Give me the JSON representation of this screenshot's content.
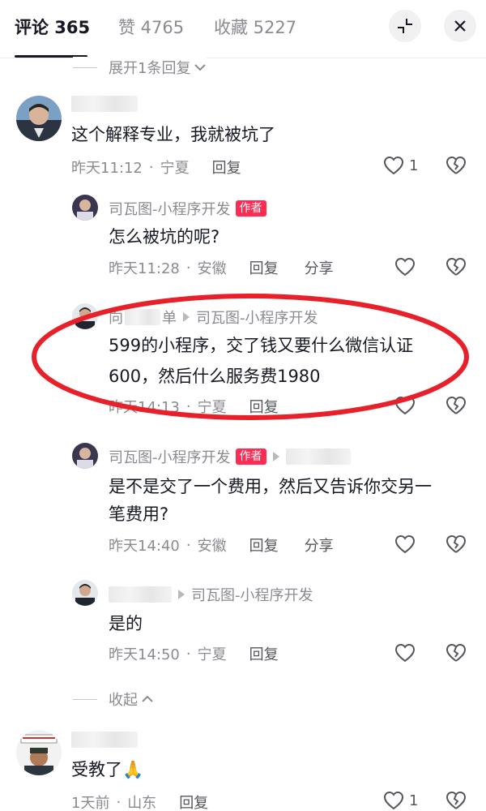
{
  "header": {
    "tabs": [
      {
        "label": "评论 365",
        "active": true
      },
      {
        "label": "赞 4765",
        "active": false
      },
      {
        "label": "收藏 5227",
        "active": false
      }
    ],
    "shrink_icon": "shrink-icon",
    "close_icon": "close-icon"
  },
  "expand_replies": "展开1条回复",
  "collapse": "收起",
  "author_badge": "作者",
  "comments": [
    {
      "text": "这个解释专业，我就被坑了",
      "time": "昨天11:12",
      "location": "宁夏",
      "reply": "回复",
      "likes": "1"
    },
    {
      "name": "司瓦图-小程序开发",
      "text": "怎么被坑的呢?",
      "time": "昨天11:28",
      "location": "安徽",
      "reply": "回复",
      "share": "分享"
    },
    {
      "name_partial_1": "向",
      "name_partial_2": "单",
      "reply_to": "司瓦图-小程序开发",
      "text_line1": "599的小程序，交了钱又要什么微信认证",
      "text_line2": "600，然后什么服务费1980",
      "time": "昨天14:13",
      "location": "宁夏",
      "reply": "回复"
    },
    {
      "name": "司瓦图-小程序开发",
      "text_line1": "是不是交了一个费用，然后又告诉你交另一",
      "text_line2": "笔费用?",
      "time": "昨天14:40",
      "location": "安徽",
      "reply": "回复",
      "share": "分享"
    },
    {
      "reply_to": "司瓦图-小程序开发",
      "text": "是的",
      "time": "昨天14:50",
      "location": "宁夏",
      "reply": "回复"
    },
    {
      "text": "受教了🙏",
      "time": "1天前",
      "location": "山东",
      "reply": "回复",
      "likes": "1"
    }
  ],
  "colors": {
    "highlight_ring": "#e8202a",
    "author_badge": "#fe2c55"
  }
}
